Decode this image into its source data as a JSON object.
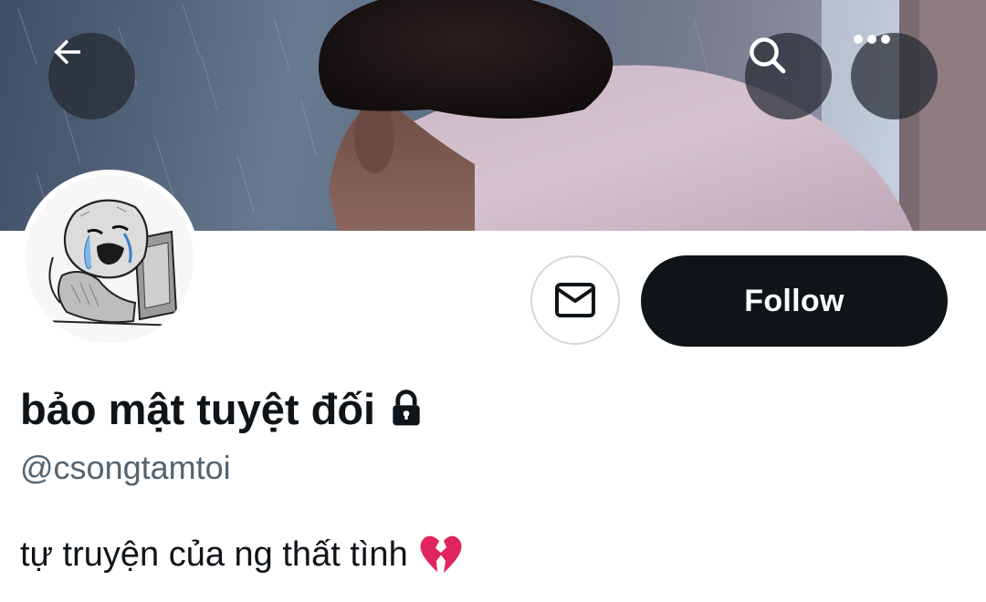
{
  "header": {
    "back_icon": "arrow-left-icon",
    "search_icon": "search-icon",
    "more_icon": "more-horizontal-icon",
    "overlay_button_color": "#242830"
  },
  "profile": {
    "display_name": "bảo mật tuyệt đối",
    "protected_icon": "lock-icon",
    "handle": "@csongtamtoi",
    "bio": "tự truyện của ng thất tình",
    "bio_emoji": "broken-heart-icon"
  },
  "actions": {
    "message_icon": "envelope-icon",
    "follow_label": "Follow"
  },
  "colors": {
    "primary_text": "#0f1419",
    "secondary_text": "#536471",
    "follow_button_bg": "#0f1419",
    "follow_button_text": "#ffffff",
    "outline": "#cfd9de",
    "broken_heart": "#e0245e"
  }
}
